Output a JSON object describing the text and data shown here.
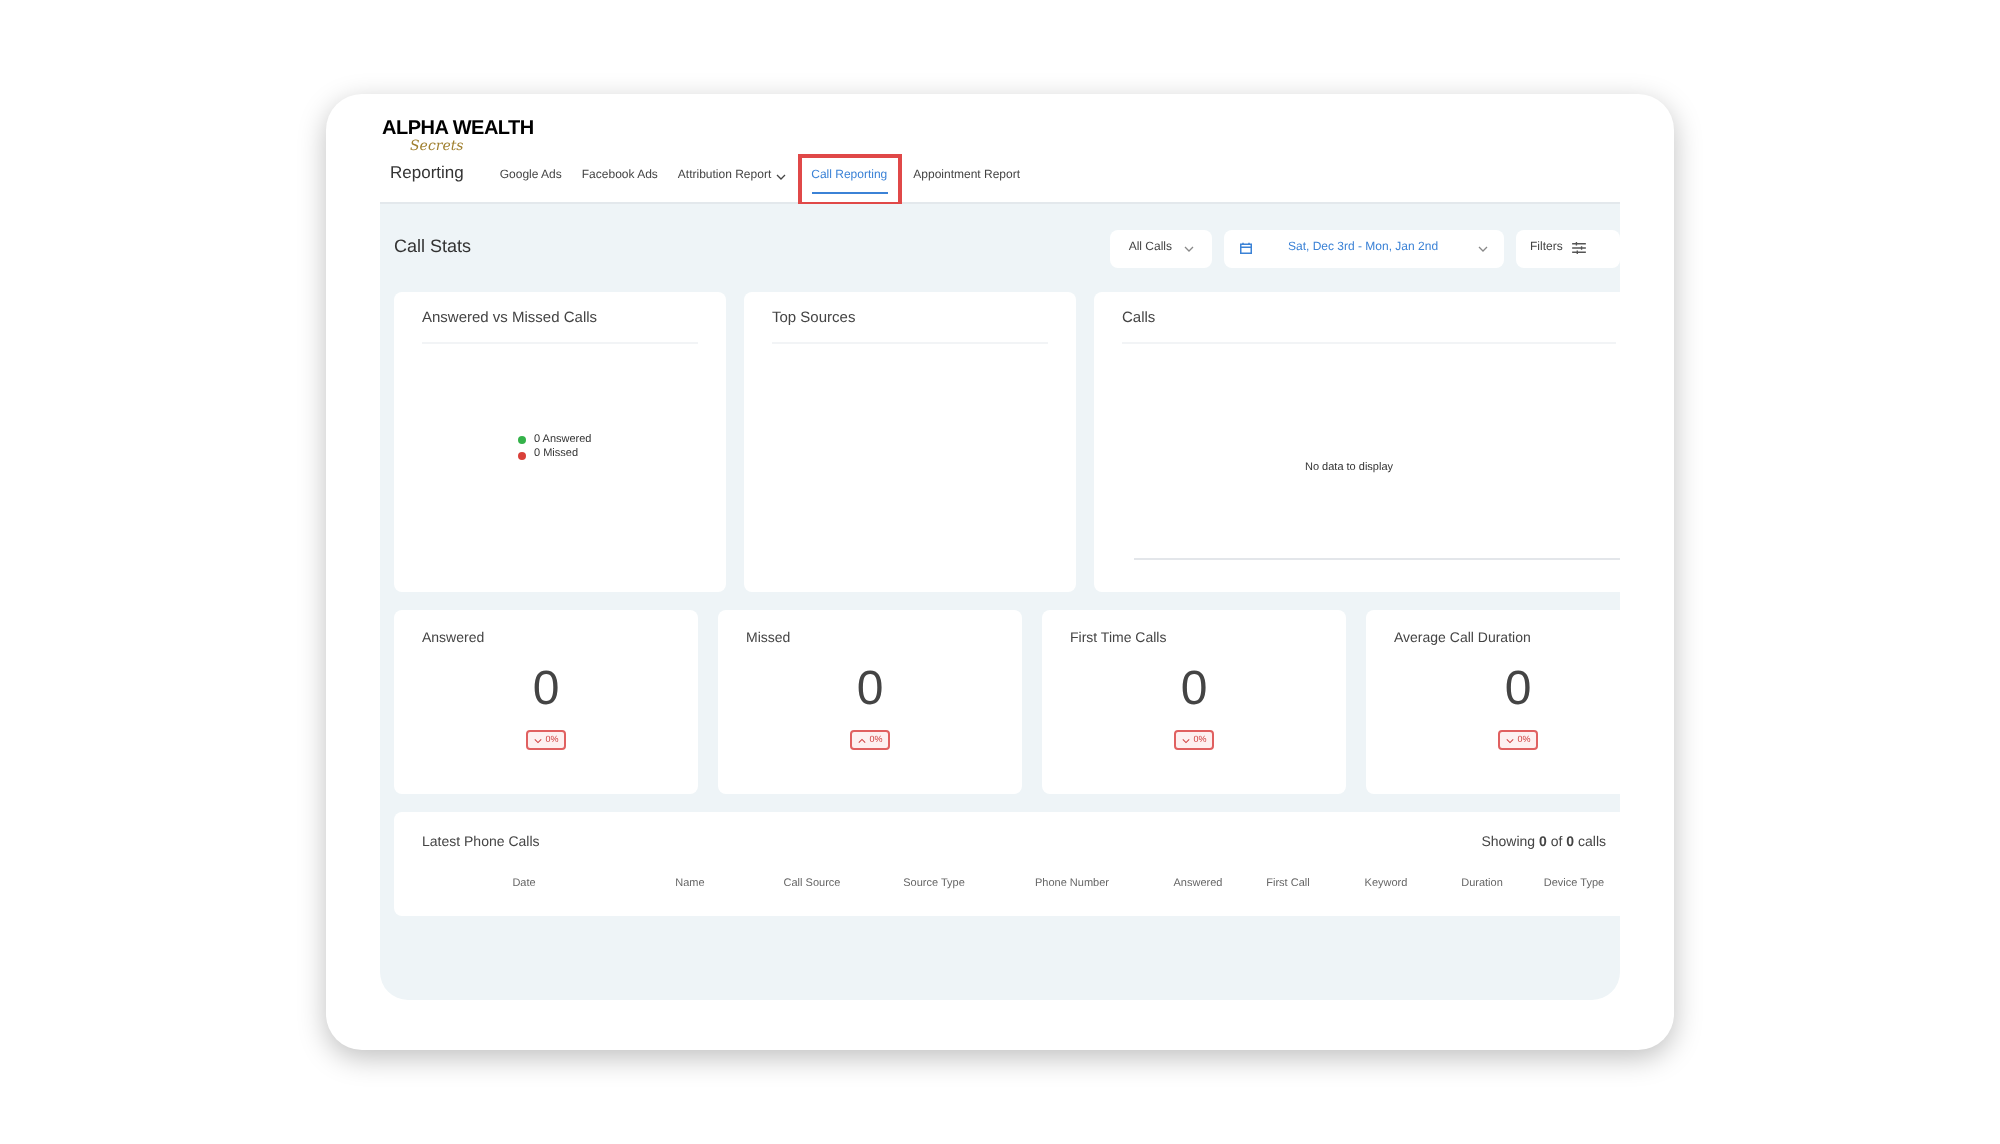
{
  "logo": {
    "title": "ALPHA WEALTH",
    "subtitle": "Secrets"
  },
  "nav": {
    "title": "Reporting",
    "tabs": [
      {
        "label": "Google Ads",
        "selected": false,
        "dropdown": false,
        "highlighted": false
      },
      {
        "label": "Facebook Ads",
        "selected": false,
        "dropdown": false,
        "highlighted": false
      },
      {
        "label": "Attribution Report",
        "selected": false,
        "dropdown": true,
        "highlighted": false
      },
      {
        "label": "Call Reporting",
        "selected": true,
        "dropdown": false,
        "highlighted": true
      },
      {
        "label": "Appointment Report",
        "selected": false,
        "dropdown": false,
        "highlighted": false
      }
    ]
  },
  "header": {
    "title": "Call Stats",
    "call_filter": "All Calls",
    "date_range": "Sat, Dec 3rd - Mon, Jan 2nd",
    "filters_button": "Filters"
  },
  "charts": [
    {
      "kind": "legend",
      "title": "Answered vs Missed Calls",
      "legend": [
        {
          "label": "0 Answered",
          "color": "#34b24a"
        },
        {
          "label": "0 Missed",
          "color": "#d9403a"
        }
      ]
    },
    {
      "kind": "empty",
      "title": "Top Sources"
    },
    {
      "kind": "message",
      "title": "Calls",
      "message": "No data to display"
    }
  ],
  "stats": [
    {
      "title": "Answered",
      "value": "0",
      "change": "0%",
      "kind": "down"
    },
    {
      "title": "Missed",
      "value": "0",
      "change": "0%",
      "kind": "up"
    },
    {
      "title": "First Time Calls",
      "value": "0",
      "change": "0%",
      "kind": "down"
    },
    {
      "title": "Average Call Duration",
      "value": "0",
      "change": "0%",
      "kind": "down"
    }
  ],
  "table": {
    "title": "Latest Phone Calls",
    "summary": "Showing **0** of **0** calls",
    "columns": [
      "Date",
      "Name",
      "Call Source",
      "Source Type",
      "Phone Number",
      "Answered",
      "First Call",
      "Keyword",
      "Duration",
      "Device Type"
    ]
  }
}
